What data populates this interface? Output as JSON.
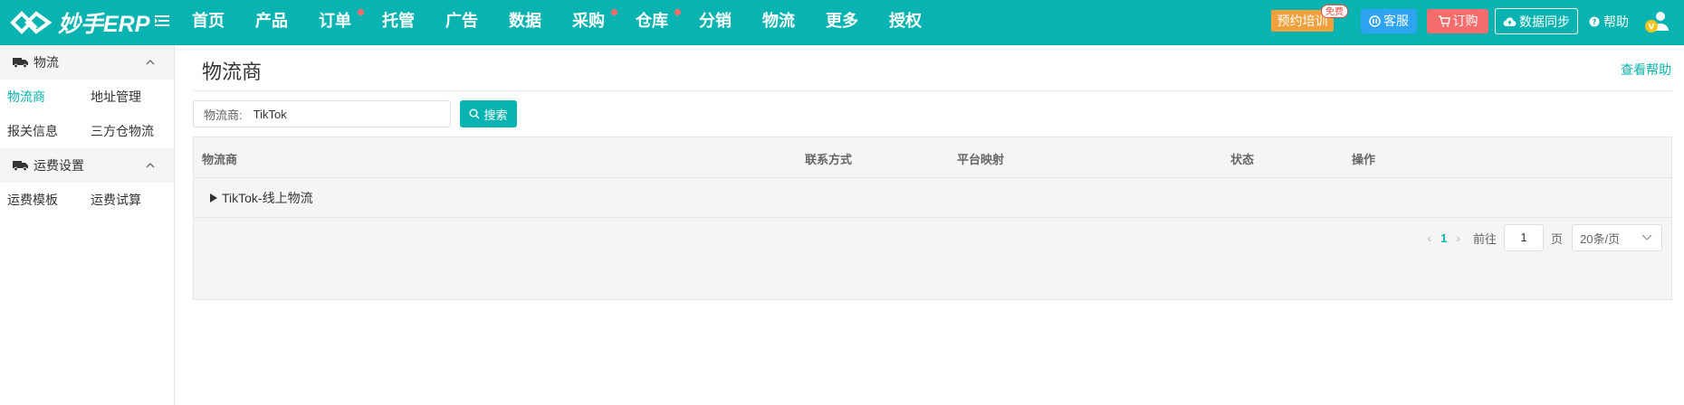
{
  "app": {
    "logo_text": "妙手ERP"
  },
  "nav": {
    "items": [
      {
        "label": "首页",
        "dot": false
      },
      {
        "label": "产品",
        "dot": false
      },
      {
        "label": "订单",
        "dot": true
      },
      {
        "label": "托管",
        "dot": false
      },
      {
        "label": "广告",
        "dot": false
      },
      {
        "label": "数据",
        "dot": false
      },
      {
        "label": "采购",
        "dot": true
      },
      {
        "label": "仓库",
        "dot": true
      },
      {
        "label": "分销",
        "dot": false
      },
      {
        "label": "物流",
        "dot": false
      },
      {
        "label": "更多",
        "dot": false
      },
      {
        "label": "授权",
        "dot": false
      }
    ]
  },
  "header_actions": {
    "training_label": "预约培训",
    "free_badge": "免费",
    "service_label": "客服",
    "order_label": "订购",
    "sync_label": "数据同步",
    "help_label": "帮助"
  },
  "sidebar": {
    "groups": [
      {
        "title": "物流",
        "icon": "truck-icon",
        "rows": [
          [
            "物流商",
            "地址管理"
          ],
          [
            "报关信息",
            "三方仓物流"
          ]
        ]
      },
      {
        "title": "运费设置",
        "icon": "truck-icon",
        "rows": [
          [
            "运费模板",
            "运费试算"
          ]
        ]
      }
    ],
    "active_item": "物流商"
  },
  "main": {
    "title": "物流商",
    "help_link": "查看帮助",
    "search": {
      "label": "物流商:",
      "value": "TikTok",
      "button": "搜索"
    },
    "table": {
      "columns": [
        "物流商",
        "联系方式",
        "平台映射",
        "状态",
        "操作"
      ],
      "rows": [
        {
          "name": "TikTok-线上物流",
          "expandable": true
        }
      ]
    },
    "pagination": {
      "current_page": "1",
      "goto_label": "前往",
      "goto_value": "1",
      "page_suffix": "页",
      "page_size": "20条/页"
    }
  },
  "colors": {
    "brand": "#08b3b1",
    "training": "#f0a03c",
    "service": "#2ea3f2",
    "order": "#f56c6c"
  }
}
